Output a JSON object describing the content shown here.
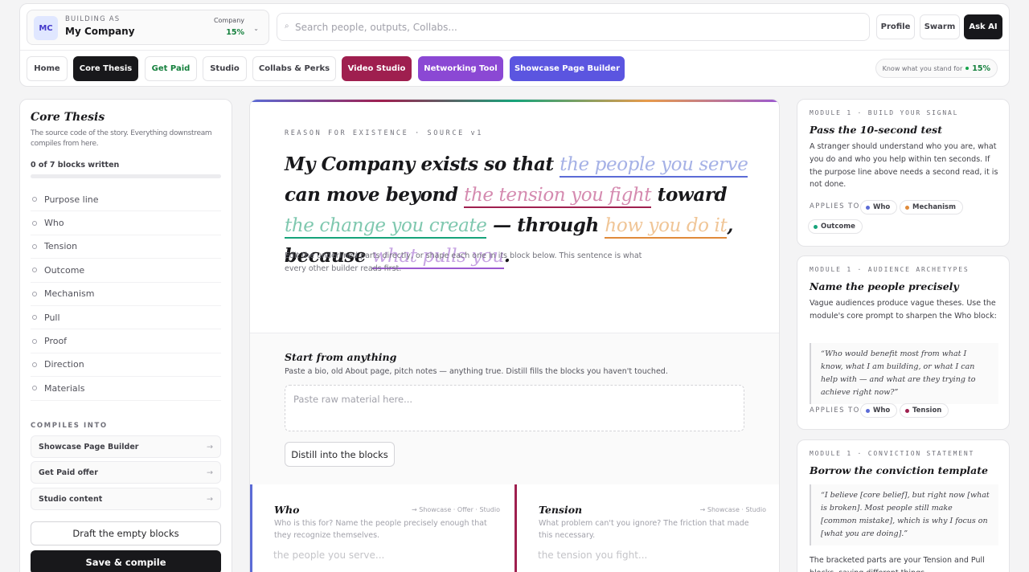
{
  "header": {
    "building_label": "BUILDING AS",
    "initials": "MC",
    "company_name": "My Company",
    "company_label": "Company",
    "company_progress": "15%",
    "search_placeholder": "Search people, outputs, Collabs...",
    "buttons": {
      "profile": "Profile",
      "swarm": "Swarm",
      "ask_ai": "Ask AI"
    }
  },
  "tabs": [
    "Home",
    "Core Thesis",
    "Get Paid",
    "Studio",
    "Collabs & Perks",
    "Video Studio",
    "Networking Tool",
    "Showcase Page Builder"
  ],
  "stand": {
    "label": "Know what you stand for",
    "value": "15%",
    "progress": 0.15
  },
  "sidebar": {
    "title": "Core Thesis",
    "subtitle": "The source code of the story. Everything downstream compiles from here.",
    "blocks_written": "0 of 7 blocks written",
    "progress": 0,
    "blocks": [
      "Purpose line",
      "Who",
      "Tension",
      "Outcome",
      "Mechanism",
      "Pull",
      "Proof",
      "Direction",
      "Materials"
    ],
    "compiles_into_title": "COMPILES INTO",
    "compiles_into": [
      "Showcase Page Builder",
      "Get Paid offer",
      "Studio content"
    ],
    "draft_button": "Draft the empty blocks",
    "save_button": "Save & compile"
  },
  "main": {
    "kicker": "REASON FOR EXISTENCE · SOURCE v1",
    "thesis": {
      "company": "My Company",
      "t1": " exists so that ",
      "who": "the people you serve",
      "t2": " can move beyond ",
      "tension": "the tension you fight",
      "t3": " toward ",
      "change": "the change you create",
      "t4": " — through ",
      "how": "how you do it",
      "t5": ", because ",
      "pull": "what pulls you",
      "t6": "."
    },
    "help": "Edit the underlined parts directly, or shape each one in its block below. This sentence is what every other builder reads first.",
    "start": {
      "title": "Start from anything",
      "desc": "Paste a bio, old About page, pitch notes — anything true. Distill fills the blocks you haven't touched.",
      "placeholder": "Paste raw material here...",
      "button": "Distill into the blocks"
    },
    "block_cards": [
      {
        "name": "Who",
        "route": "→ Showcase · Offer · Studio",
        "question": "Who is this for? Name the people precisely enough that they recognize themselves.",
        "placeholder": "the people you serve..."
      },
      {
        "name": "Tension",
        "route": "→ Showcase · Studio",
        "question": "What problem can't you ignore? The friction that made this necessary.",
        "placeholder": "the tension you fight..."
      }
    ]
  },
  "modules": [
    {
      "kicker": "MODULE 1 · BUILD YOUR SIGNAL",
      "title": "Pass the 10-second test",
      "text": "A stranger should understand who you are, what you do and who you help within ten seconds. If the purpose line above needs a second read, it is not done.",
      "applies_label": "APPLIES TO",
      "chips": [
        "Who",
        "Mechanism",
        "Outcome"
      ]
    },
    {
      "kicker": "MODULE 1 · AUDIENCE ARCHETYPES",
      "title": "Name the people precisely",
      "text": "Vague audiences produce vague theses. Use the module's core prompt to sharpen the Who block:",
      "quote": "“Who would benefit most from what I know, what I am building, or what I can help with — and what are they trying to achieve right now?”",
      "applies_label": "APPLIES TO",
      "chips": [
        "Who",
        "Tension"
      ]
    },
    {
      "kicker": "MODULE 1 · CONVICTION STATEMENT",
      "title": "Borrow the conviction template",
      "quote": "“I believe [core belief], but right now [what is broken]. Most people still make [common mistake], which is why I focus on [what you are doing].”",
      "text": "The bracketed parts are your Tension and Pull blocks, saying different things."
    }
  ],
  "colors": {
    "who": "#5b6bd6",
    "tension": "#9f1f4f",
    "change": "#16a37a",
    "how": "#e08a3a",
    "pull": "#9b59d0",
    "accent_green": "#15803d"
  }
}
